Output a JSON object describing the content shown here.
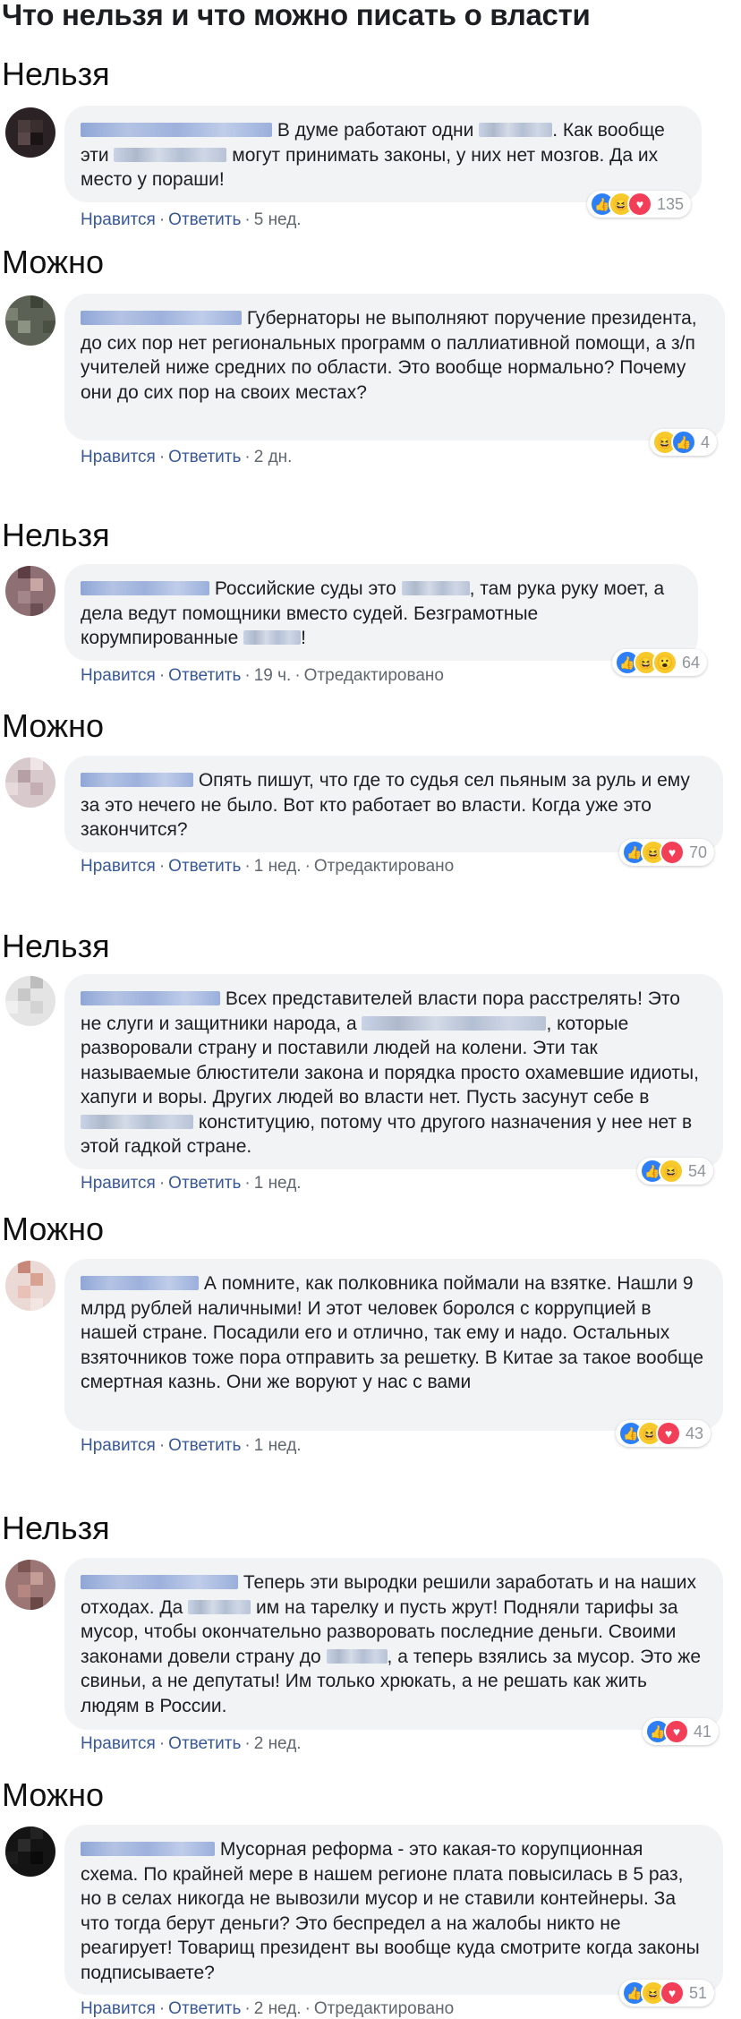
{
  "title": "Что нельзя и что можно писать о власти",
  "actions": {
    "like": "Нравится",
    "reply": "Ответить",
    "edited": "Отредактировано",
    "sep": "·"
  },
  "reaction_icons": {
    "like": "thumbs-up-icon",
    "haha": "laughing-face-icon",
    "love": "heart-icon",
    "wow": "surprised-face-icon"
  },
  "colors": {
    "link": "#385898",
    "bubble": "#f2f3f5",
    "like": "#2d7ff9",
    "love": "#f33e58",
    "haha": "#f7c92a"
  },
  "items": [
    {
      "verdict": "Нельзя",
      "text": "В думе работают одни ███. Как вообще эти ███ могут принимать законы, у них нет мозгов. Да их место у пораши!",
      "time": "5 нед.",
      "count": "135"
    },
    {
      "verdict": "Можно",
      "text": "Губернаторы не выполняют поручение президента, до сих пор нет региональных программ о паллиативной помощи, а з/п учителей ниже средних по области. Это вообще нормально? Почему они до сих пор на своих местах?",
      "time": "2 дн.",
      "count": "4"
    },
    {
      "verdict": "Нельзя",
      "text": "Российские суды это ███, там рука руку моет, а дела ведут помощники вместо судей. Безграмотные корумпированные ███!",
      "time": "19 ч.",
      "count": "64"
    },
    {
      "verdict": "Можно",
      "text": "Опять пишут, что где то судья сел пьяным за руль и ему за это нечего не было. Вот кто работает во власти. Когда уже это закончится?",
      "time": "1 нед.",
      "count": "70"
    },
    {
      "verdict": "Нельзя",
      "text": "Всех представителей власти пора расстрелять! Это не слуги и защитники народа, а ███, которые разворовали страну и поставили людей на колени. Эти так называемые блюстители закона и порядка просто охамевшие идиоты, хапуги и воры. Других людей во власти нет. Пусть засунут себе в ███ конституцию, потому что другого назначения у нее нет в этой гадкой стране.",
      "time": "1 нед.",
      "count": "54"
    },
    {
      "verdict": "Можно",
      "text": "А помните, как полковника поймали на взятке. Нашли 9 млрд рублей наличными! И этот человек боролся с коррупцией в нашей стране. Посадили его и отлично, так ему и надо. Остальных взяточников тоже пора отправить за решетку. В Китае за такое вообще смертная казнь. Они же воруют у нас с вами",
      "time": "1 нед.",
      "count": "43"
    },
    {
      "verdict": "Нельзя",
      "text": "Теперь эти выродки решили заработать и на наших отходах. Да ███ им на тарелку и пусть жрут! Подняли тарифы за мусор, чтобы окончательно разворовать последние деньги. Своими законами довели страну до ███, а теперь взялись за мусор. Это же свиньи, а не депутаты! Им только хрюкать, а не решать как жить людям в России.",
      "time": "2 нед.",
      "count": "41"
    },
    {
      "verdict": "Можно",
      "text": "Мусорная реформа - это какая-то корупционная схема. По крайней мере в нашем регионе плата повысилась в 5 раз, но в селах никогда не вывозили мусор и не ставили контейнеры. За что тогда берут деньги? Это беспредел а на жалобы никто не реагирует! Товарищ президент вы вообще куда смотрите когда законы подписываете?",
      "time": "2 нед.",
      "count": "51"
    }
  ]
}
